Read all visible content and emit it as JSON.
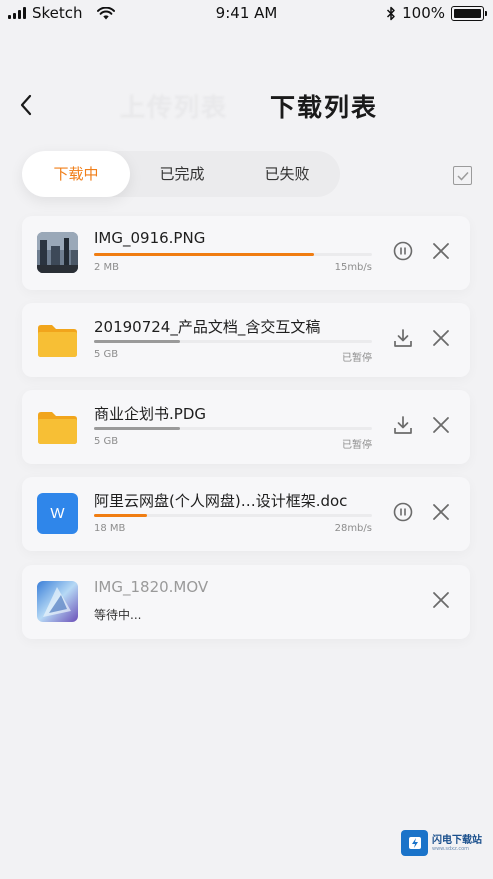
{
  "status_bar": {
    "carrier": "Sketch",
    "time": "9:41 AM",
    "battery": "100%"
  },
  "header": {
    "inactive_title": "上传列表",
    "title": "下载列表"
  },
  "tabs": [
    {
      "label": "下载中",
      "active": true
    },
    {
      "label": "已完成",
      "active": false
    },
    {
      "label": "已失败",
      "active": false
    }
  ],
  "downloads": [
    {
      "name": "IMG_0916.PNG",
      "size": "2 MB",
      "status": "15mb/s",
      "progress": 0.79,
      "progress_color": "#f07d12",
      "action": "pause-icon",
      "thumb": "photo-thumbnail"
    },
    {
      "name": "20190724_产品文档_含交互文稿",
      "size": "5 GB",
      "status": "已暂停",
      "progress": 0.31,
      "progress_color": "#9a9a9a",
      "action": "download-icon",
      "thumb": "folder-icon"
    },
    {
      "name": "商业企划书.PDG",
      "size": "5 GB",
      "status": "已暂停",
      "progress": 0.31,
      "progress_color": "#9a9a9a",
      "action": "download-icon",
      "thumb": "folder-icon"
    },
    {
      "name": "阿里云网盘(个人网盘)…设计框架.doc",
      "size": "18 MB",
      "status": "28mb/s",
      "progress": 0.19,
      "progress_color": "#f07d12",
      "action": "pause-icon",
      "thumb": "word-doc-icon",
      "thumb_letter": "W"
    },
    {
      "name": "IMG_1820.MOV",
      "status": "等待中...",
      "thumb": "video-thumbnail"
    }
  ],
  "watermark": {
    "text": "闪电下载站",
    "sub": "www.sdxz.com"
  },
  "colors": {
    "accent": "#f07d12",
    "background": "#f2f2f4",
    "card": "#f7f7f9",
    "word_blue": "#2f86ea",
    "folder_yellow": "#f6b92b"
  }
}
